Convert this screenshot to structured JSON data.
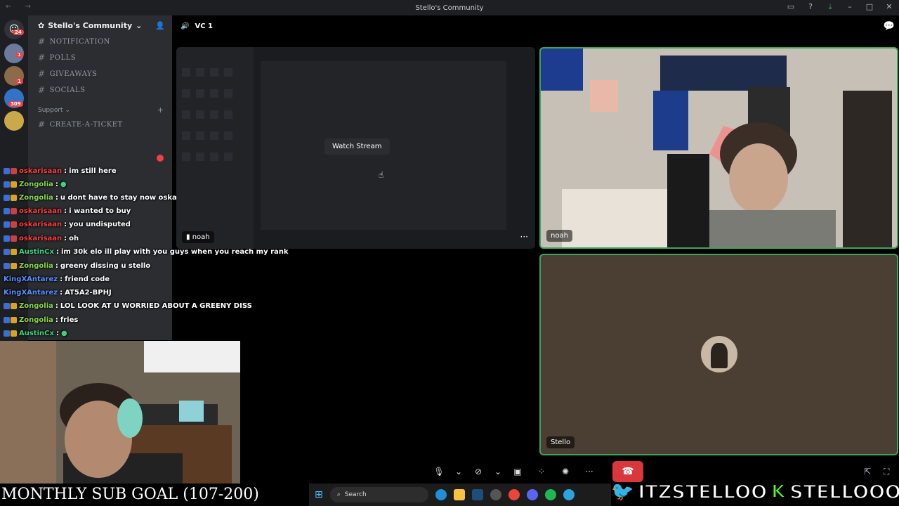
{
  "window": {
    "title": "Stello's Community"
  },
  "guilds": {
    "badges": [
      "24",
      "1",
      "1",
      "309"
    ]
  },
  "server": {
    "name": "Stello's Community",
    "channels": [
      "NOTIFICATION",
      "POLLS",
      "GIVEAWAYS",
      "SOCIALS"
    ],
    "support_label": "Support",
    "support_channels": [
      "CREATE-A-TICKET"
    ]
  },
  "chat": [
    {
      "user": "oskarisaan",
      "color": "#ff3b3b",
      "msg": "im still here"
    },
    {
      "user": "Zongolia",
      "color": "#8bd450",
      "msg": "u dont have to stay now oskar leave"
    },
    {
      "user": "oskarisaan",
      "color": "#ff3b3b",
      "msg": "i wanted to buy"
    },
    {
      "user": "oskarisaan",
      "color": "#ff3b3b",
      "msg": "you undisputed"
    },
    {
      "user": "oskarisaan",
      "color": "#ff3b3b",
      "msg": "oh"
    },
    {
      "user": "AustinCx",
      "color": "#3ed17f",
      "msg": "im 30k elo ill play with you guys when you reach my rank"
    },
    {
      "user": "Zongolia",
      "color": "#8bd450",
      "msg": "greeny dissing u stello"
    },
    {
      "user": "KingXAntarez",
      "color": "#5b8cff",
      "msg": "friend code"
    },
    {
      "user": "KingXAntarez",
      "color": "#5b8cff",
      "msg": "AT5A2-BPHJ"
    },
    {
      "user": "Zongolia",
      "color": "#8bd450",
      "msg": "LOL LOOK AT U WORRIED ABOUT A GREENY DISS"
    },
    {
      "user": "Zongolia",
      "color": "#8bd450",
      "msg": "fries"
    },
    {
      "user": "AustinCx",
      "color": "#3ed17f",
      "msg": ""
    }
  ],
  "voice": {
    "channel": "VC 1",
    "stream": {
      "user": "noah",
      "watch_label": "Watch Stream"
    },
    "webcam_user": "noah",
    "avatar_user": "Stello"
  },
  "overlay": {
    "sub_goal": "MONTHLY SUB GOAL (107-200)",
    "twitter": "ITZSTELLOO",
    "kick": "STELLOOO"
  },
  "taskbar": {
    "search": "Search"
  },
  "colors": {
    "speaking": "#3ba55d",
    "hangup": "#da373c",
    "twitter": "#1d9bf0",
    "kick": "#53fc18"
  }
}
